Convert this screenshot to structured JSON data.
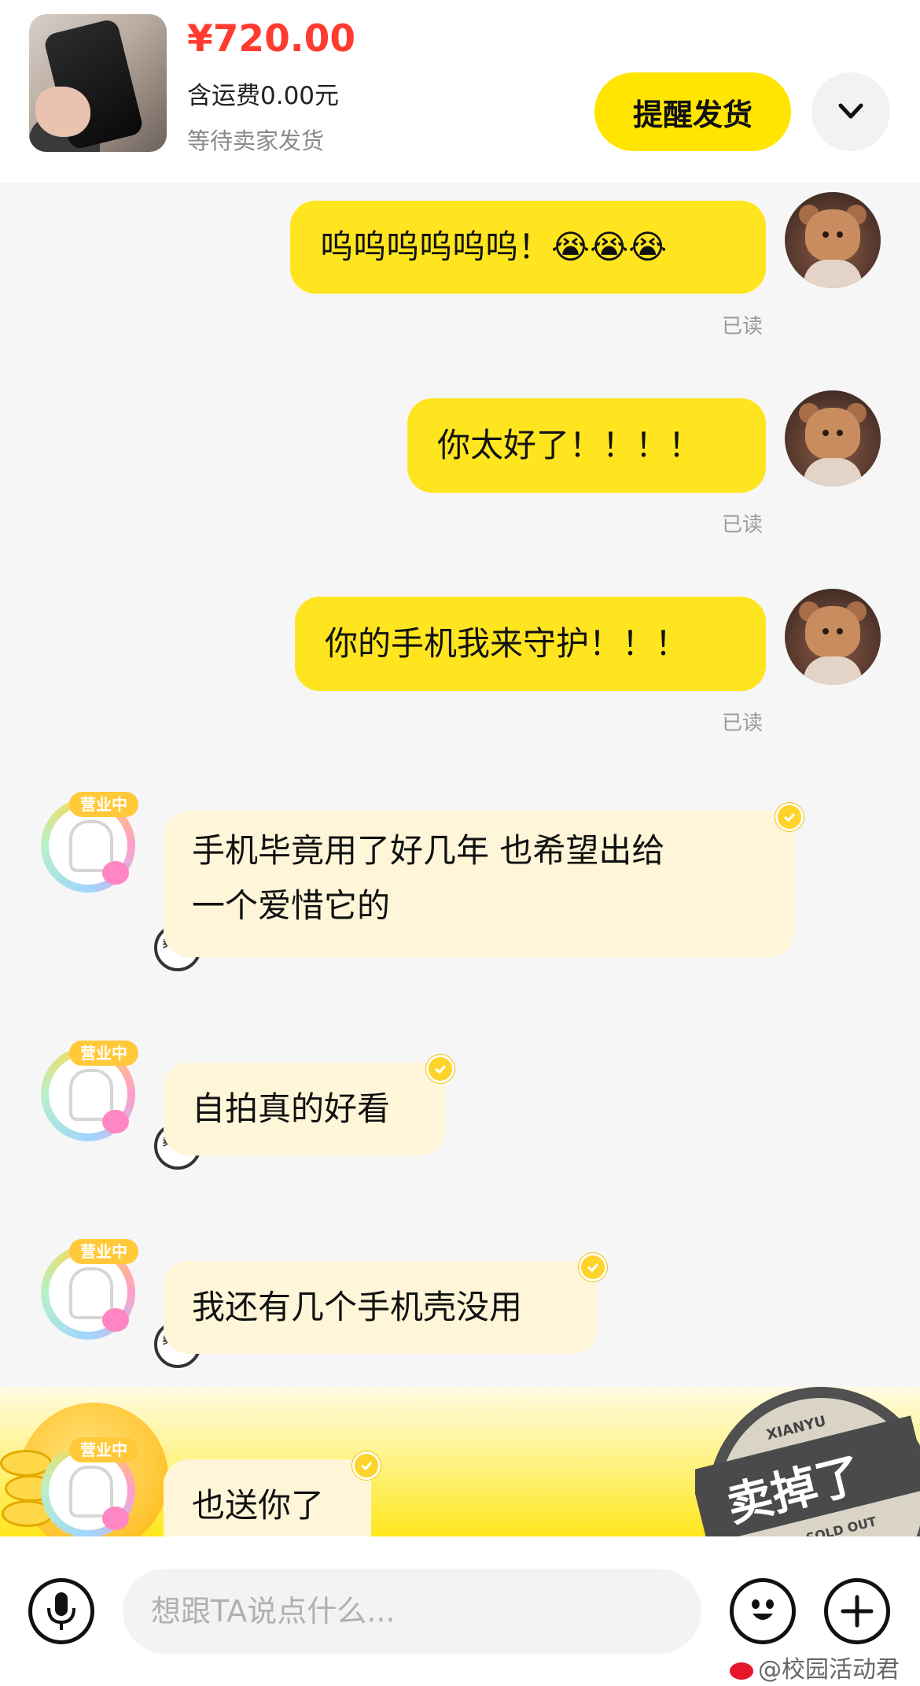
{
  "order": {
    "price": "¥720.00",
    "shipping": "含运费0.00元",
    "status": "等待卖家发货",
    "remind_label": "提醒发货",
    "expand_icon": "chevron-down-icon"
  },
  "messages": [
    {
      "from": "me",
      "text": "呜呜呜呜呜呜！😭😭😭",
      "read": "已读"
    },
    {
      "from": "me",
      "text": "你太好了！！！！",
      "read": "已读"
    },
    {
      "from": "me",
      "text": "你的手机我来守护！！！",
      "read": "已读"
    },
    {
      "from": "seller",
      "lines": [
        "手机毕竟用了好几年 也希望出给",
        "一个爱惜它的"
      ]
    },
    {
      "from": "seller",
      "lines": [
        "自拍真的好看"
      ]
    },
    {
      "from": "seller",
      "lines": [
        "我还有几个手机壳没用"
      ]
    },
    {
      "from": "seller",
      "lines": [
        "也送你了"
      ]
    }
  ],
  "seller_avatar": {
    "open_badge": "营业中",
    "sold_badge": "卖掉了"
  },
  "sold_stamp": {
    "brand": "XIANYU",
    "main": "卖掉了",
    "sub": "SOLD OUT"
  },
  "input": {
    "placeholder": "想跟TA说点什么...",
    "voice_icon": "microphone-icon",
    "emoji_icon": "emoji-icon",
    "add_icon": "plus-icon"
  },
  "watermark": "@校园活动君",
  "colors": {
    "accent_yellow": "#ffe51f",
    "price_red": "#ff3b30",
    "seller_bubble": "#fff6d9"
  }
}
